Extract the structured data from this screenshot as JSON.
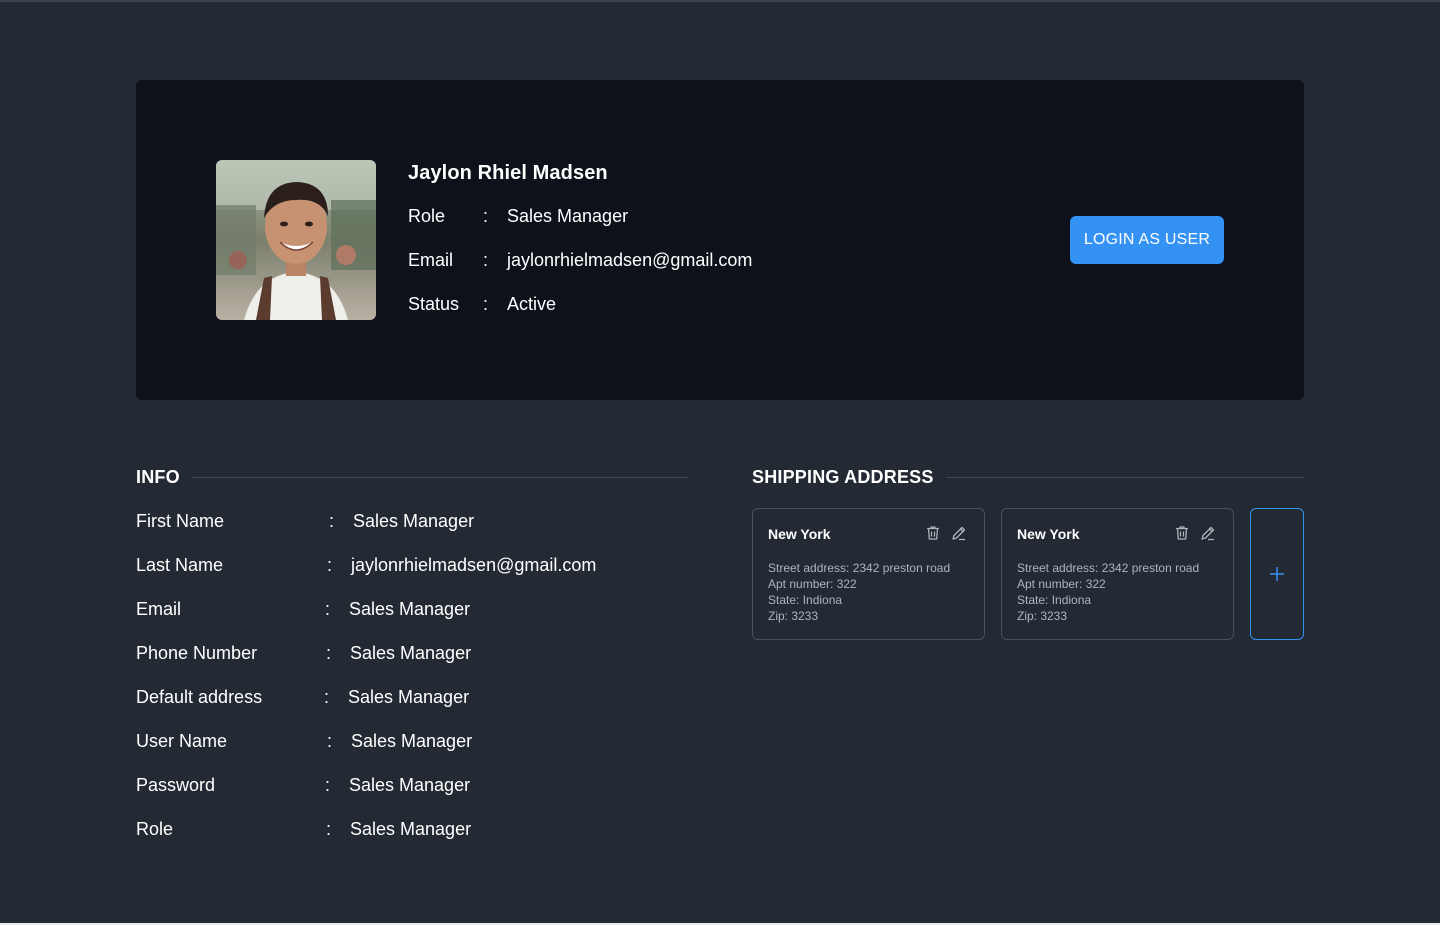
{
  "profile": {
    "name": "Jaylon Rhiel Madsen",
    "avatar_alt": "profile photo",
    "rows": [
      {
        "label": "Role",
        "separator": ":",
        "value": "Sales Manager"
      },
      {
        "label": "Email",
        "separator": ":",
        "value": "jaylonrhielmadsen@gmail.com"
      },
      {
        "label": "Status",
        "separator": ":",
        "value": "Active"
      }
    ],
    "login_button": "LOGIN AS USER"
  },
  "info": {
    "title": "INFO",
    "rows": [
      {
        "label": "First Name",
        "separator": ":",
        "value": "Sales Manager"
      },
      {
        "label": "Last Name",
        "separator": ":",
        "value": "jaylonrhielmadsen@gmail.com"
      },
      {
        "label": "Email",
        "separator": ":",
        "value": "Sales Manager"
      },
      {
        "label": "Phone Number",
        "separator": ":",
        "value": "Sales Manager"
      },
      {
        "label": "Default address",
        "separator": ":",
        "value": "Sales Manager"
      },
      {
        "label": "User Name",
        "separator": ":",
        "value": "Sales Manager"
      },
      {
        "label": "Password",
        "separator": ":",
        "value": "Sales Manager"
      },
      {
        "label": "Role",
        "separator": ":",
        "value": "Sales Manager"
      }
    ]
  },
  "shipping": {
    "title": "SHIPPING ADDRESS",
    "addresses": [
      {
        "city": "New York",
        "street": "Street address: 2342 preston road",
        "apt": "Apt number: 322",
        "state": "State: Indiona",
        "zip": "Zip: 3233"
      },
      {
        "city": "New York",
        "street": "Street address: 2342 preston road",
        "apt": "Apt number: 322",
        "state": "State: Indiona",
        "zip": "Zip: 3233"
      }
    ],
    "add_icon": "plus-icon"
  },
  "colors": {
    "background": "#232a33",
    "card": "#0c111a",
    "accent": "#3592f5",
    "muted_text": "#aeb4bc"
  }
}
